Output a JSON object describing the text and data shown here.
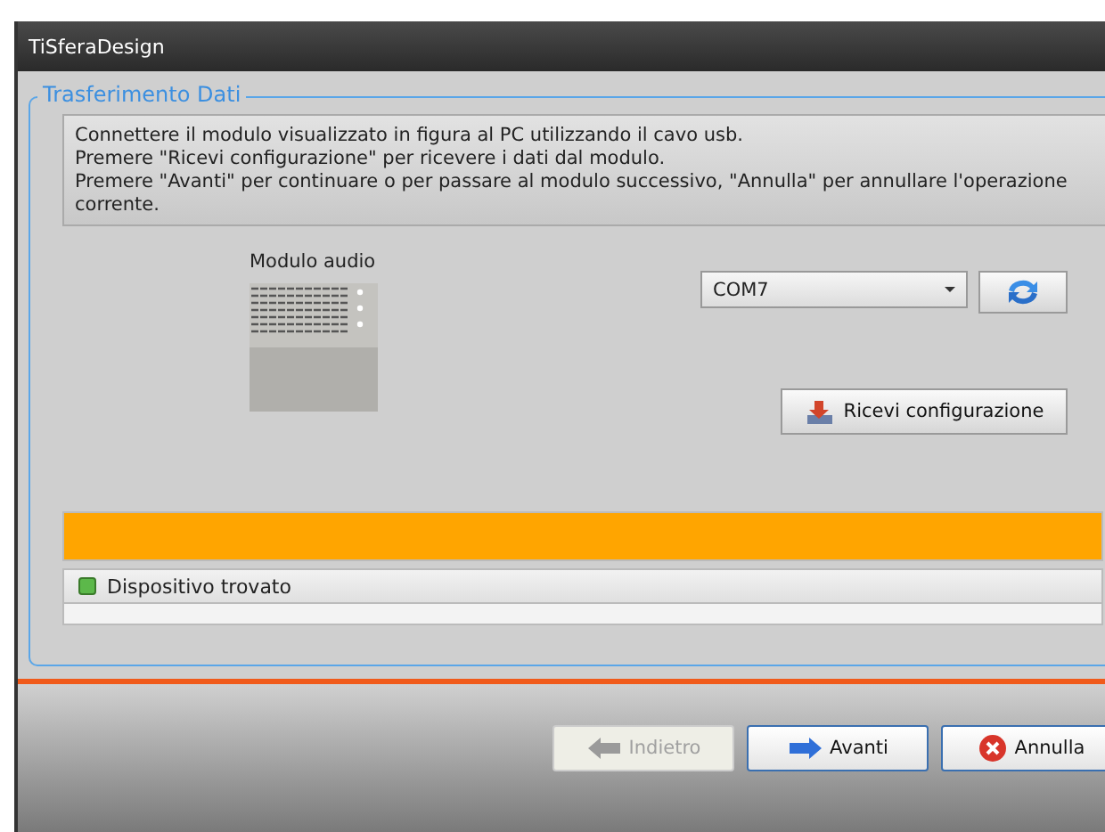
{
  "window": {
    "title": "TiSferaDesign"
  },
  "group": {
    "title": "Trasferimento Dati"
  },
  "instructions": [
    "Connettere il modulo visualizzato in figura al PC utilizzando il cavo usb.",
    "Premere \"Ricevi configurazione\" per ricevere i dati dal modulo.",
    "Premere \"Avanti\" per continuare o per passare al modulo successivo, \"Annulla\" per annullare l'operazione corrente."
  ],
  "module": {
    "label": "Modulo audio"
  },
  "port": {
    "value": "COM7"
  },
  "receive_button": "Ricevi configurazione",
  "progress": {
    "level": 1
  },
  "log": [
    {
      "text": "Dispositivo trovato",
      "color": "#5cb84a"
    }
  ],
  "buttons": [
    {
      "label": "Indietro",
      "kind": "back",
      "disabled": true
    },
    {
      "label": "Avanti",
      "kind": "next",
      "disabled": false
    },
    {
      "label": "Annulla",
      "kind": "cancel",
      "disabled": false
    }
  ]
}
